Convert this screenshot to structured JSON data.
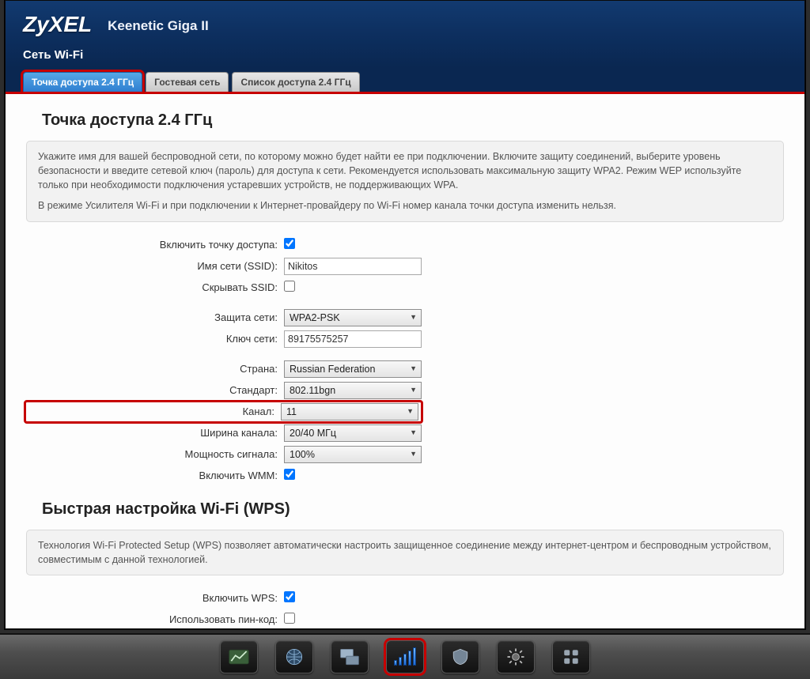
{
  "brand": "ZyXEL",
  "model": "Keenetic Giga II",
  "section": "Сеть Wi-Fi",
  "tabs": [
    {
      "label": "Точка доступа 2.4 ГГц",
      "active": true
    },
    {
      "label": "Гостевая сеть",
      "active": false
    },
    {
      "label": "Список доступа 2.4 ГГц",
      "active": false
    }
  ],
  "panel": {
    "title": "Точка доступа 2.4 ГГц",
    "hint1": "Укажите имя для вашей беспроводной сети, по которому можно будет найти ее при подключении. Включите защиту соединений, выберите уровень безопасности и введите сетевой ключ (пароль) для доступа к сети. Рекомендуется использовать максимальную защиту WPA2. Режим WEP используйте только при необходимости подключения устаревших устройств, не поддерживающих WPA.",
    "hint2": "В режиме Усилителя Wi-Fi и при подключении к Интернет-провайдеру по Wi-Fi номер канала точки доступа изменить нельзя."
  },
  "labels": {
    "enable_ap": "Включить точку доступа:",
    "ssid": "Имя сети (SSID):",
    "hide_ssid": "Скрывать SSID:",
    "security": "Защита сети:",
    "key": "Ключ сети:",
    "country": "Страна:",
    "standard": "Стандарт:",
    "channel": "Канал:",
    "width": "Ширина канала:",
    "power": "Мощность сигнала:",
    "wmm": "Включить WMM:"
  },
  "values": {
    "enable_ap": true,
    "ssid": "Nikitos",
    "hide_ssid": false,
    "security": "WPA2-PSK",
    "key": "89175575257",
    "country": "Russian Federation",
    "standard": "802.11bgn",
    "channel": "11",
    "width": "20/40 МГц",
    "power": "100%",
    "wmm": true
  },
  "wps": {
    "title": "Быстрая настройка Wi-Fi (WPS)",
    "hint": "Технология Wi-Fi Protected Setup (WPS) позволяет автоматически настроить защищенное соединение между интернет-центром и беспроводным устройством, совместимым с данной технологией.",
    "labels": {
      "enable": "Включить WPS:",
      "use_pin": "Использовать пин-код:"
    },
    "values": {
      "enable": true,
      "use_pin": false
    }
  },
  "taskbar": {
    "items": [
      "dashboard",
      "globe",
      "monitor",
      "wifi",
      "shield",
      "gear",
      "apps"
    ],
    "active": "wifi"
  }
}
